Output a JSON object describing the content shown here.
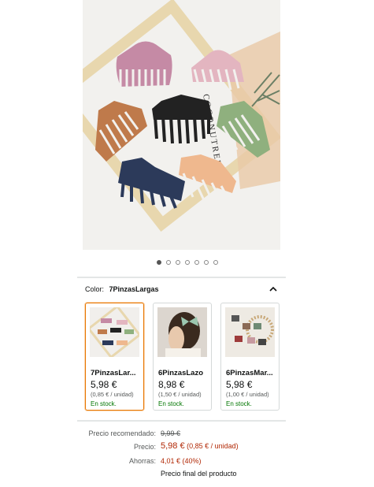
{
  "product": {
    "gallery": {
      "image_alt": "Pinzas de pelo grandes",
      "slides": 7,
      "active_slide": 1
    },
    "hero_text": "COCONUTREE",
    "color": {
      "label": "Color:",
      "selected": "7PinzasLargas"
    },
    "variants": [
      {
        "name": "7PinzasLar...",
        "price": "5,98 €",
        "unit_price": "(0,85 € / unidad)",
        "stock": "En stock.",
        "selected": true
      },
      {
        "name": "6PinzasLazo",
        "price": "8,98 €",
        "unit_price": "(1,50 € / unidad)",
        "stock": "En stock.",
        "selected": false
      },
      {
        "name": "6PinzasMar...",
        "price": "5,98 €",
        "unit_price": "(1,00 € / unidad)",
        "stock": "En stock.",
        "selected": false
      }
    ],
    "pricing": {
      "recommended_label": "Precio recomendado:",
      "recommended_value": "9,99 €",
      "price_label": "Precio:",
      "price_value": "5,98 €",
      "price_unit": "(0,85 € / unidad)",
      "savings_label": "Ahorras:",
      "savings_value": "4,01 € (40%)",
      "final_note": "Precio final del producto"
    }
  },
  "icons": {
    "share": "share-icon",
    "collapse": "chevron-up-icon"
  },
  "colors": {
    "selected_border": "#e77600",
    "price_red": "#b12704",
    "stock_green": "#007600"
  }
}
